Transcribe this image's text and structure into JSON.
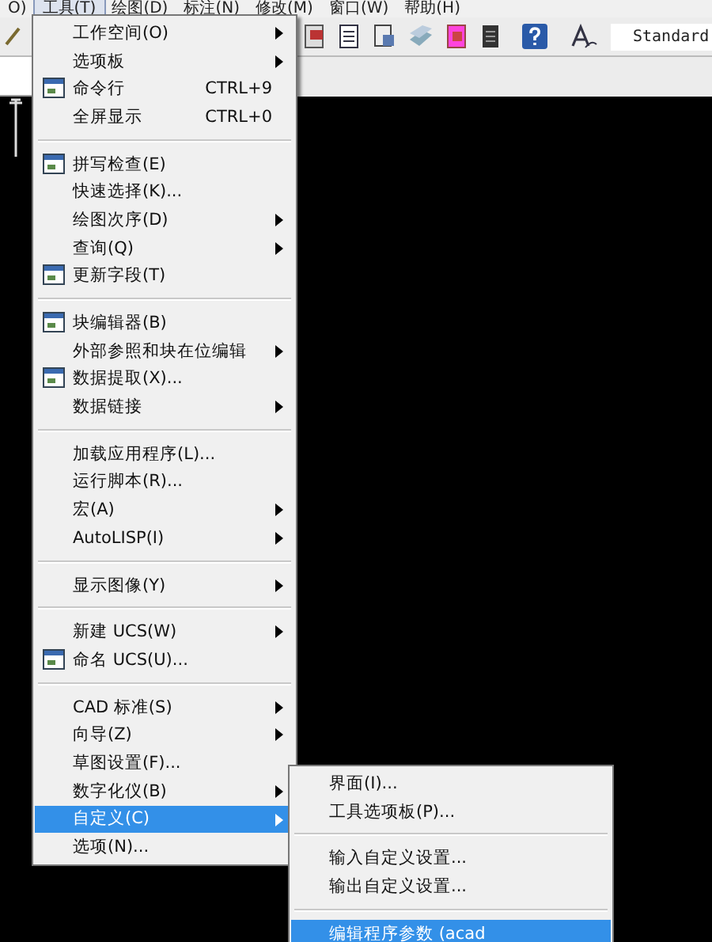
{
  "menubar": [
    {
      "label": "O)",
      "selected": false
    },
    {
      "label": "工具(T)",
      "selected": true
    },
    {
      "label": "绘图(D)",
      "selected": false
    },
    {
      "label": "标注(N)",
      "selected": false
    },
    {
      "label": "修改(M)",
      "selected": false
    },
    {
      "label": "窗口(W)",
      "selected": false
    },
    {
      "label": "帮助(H)",
      "selected": false
    }
  ],
  "toolbar": {
    "style_field": "Standard"
  },
  "menu": {
    "items": [
      {
        "kind": "item",
        "label": "工作空间(O)",
        "submenu": true,
        "selected": false
      },
      {
        "kind": "item",
        "label": "选项板",
        "submenu": true,
        "selected": false
      },
      {
        "kind": "item",
        "label": "命令行",
        "shortcut": "CTRL+9",
        "icon": true,
        "selected": false
      },
      {
        "kind": "item",
        "label": "全屏显示",
        "shortcut": "CTRL+0",
        "selected": false
      },
      {
        "kind": "separator"
      },
      {
        "kind": "item",
        "label": "拼写检查(E)",
        "icon": true,
        "selected": false
      },
      {
        "kind": "item",
        "label": "快速选择(K)...",
        "selected": false
      },
      {
        "kind": "item",
        "label": "绘图次序(D)",
        "submenu": true,
        "selected": false
      },
      {
        "kind": "item",
        "label": "查询(Q)",
        "submenu": true,
        "selected": false
      },
      {
        "kind": "item",
        "label": "更新字段(T)",
        "icon": true,
        "selected": false
      },
      {
        "kind": "separator"
      },
      {
        "kind": "item",
        "label": "块编辑器(B)",
        "icon": true,
        "selected": false
      },
      {
        "kind": "item",
        "label": "外部参照和块在位编辑",
        "submenu": true,
        "selected": false
      },
      {
        "kind": "item",
        "label": "数据提取(X)...",
        "icon": true,
        "selected": false
      },
      {
        "kind": "item",
        "label": "数据链接",
        "submenu": true,
        "selected": false
      },
      {
        "kind": "separator"
      },
      {
        "kind": "item",
        "label": "加载应用程序(L)...",
        "selected": false
      },
      {
        "kind": "item",
        "label": "运行脚本(R)...",
        "selected": false
      },
      {
        "kind": "item",
        "label": "宏(A)",
        "submenu": true,
        "selected": false
      },
      {
        "kind": "item",
        "label": "AutoLISP(I)",
        "submenu": true,
        "selected": false
      },
      {
        "kind": "separator"
      },
      {
        "kind": "item",
        "label": "显示图像(Y)",
        "submenu": true,
        "selected": false
      },
      {
        "kind": "separator"
      },
      {
        "kind": "item",
        "label": "新建 UCS(W)",
        "submenu": true,
        "selected": false
      },
      {
        "kind": "item",
        "label": "命名 UCS(U)...",
        "icon": true,
        "selected": false
      },
      {
        "kind": "separator"
      },
      {
        "kind": "item",
        "label": "CAD 标准(S)",
        "submenu": true,
        "selected": false
      },
      {
        "kind": "item",
        "label": "向导(Z)",
        "submenu": true,
        "selected": false
      },
      {
        "kind": "item",
        "label": "草图设置(F)...",
        "selected": false
      },
      {
        "kind": "item",
        "label": "数字化仪(B)",
        "submenu": true,
        "selected": false
      },
      {
        "kind": "item",
        "label": "自定义(C)",
        "submenu": true,
        "selected": true
      },
      {
        "kind": "item",
        "label": "选项(N)...",
        "selected": false
      }
    ]
  },
  "submenu": {
    "items": [
      {
        "kind": "item",
        "label": "界面(I)...",
        "selected": false
      },
      {
        "kind": "item",
        "label": "工具选项板(P)...",
        "selected": false
      },
      {
        "kind": "separator"
      },
      {
        "kind": "item",
        "label": "输入自定义设置...",
        "selected": false
      },
      {
        "kind": "item",
        "label": "输出自定义设置...",
        "selected": false
      },
      {
        "kind": "separator"
      },
      {
        "kind": "item",
        "label": "编辑程序参数 (acad",
        "selected": true
      }
    ]
  }
}
